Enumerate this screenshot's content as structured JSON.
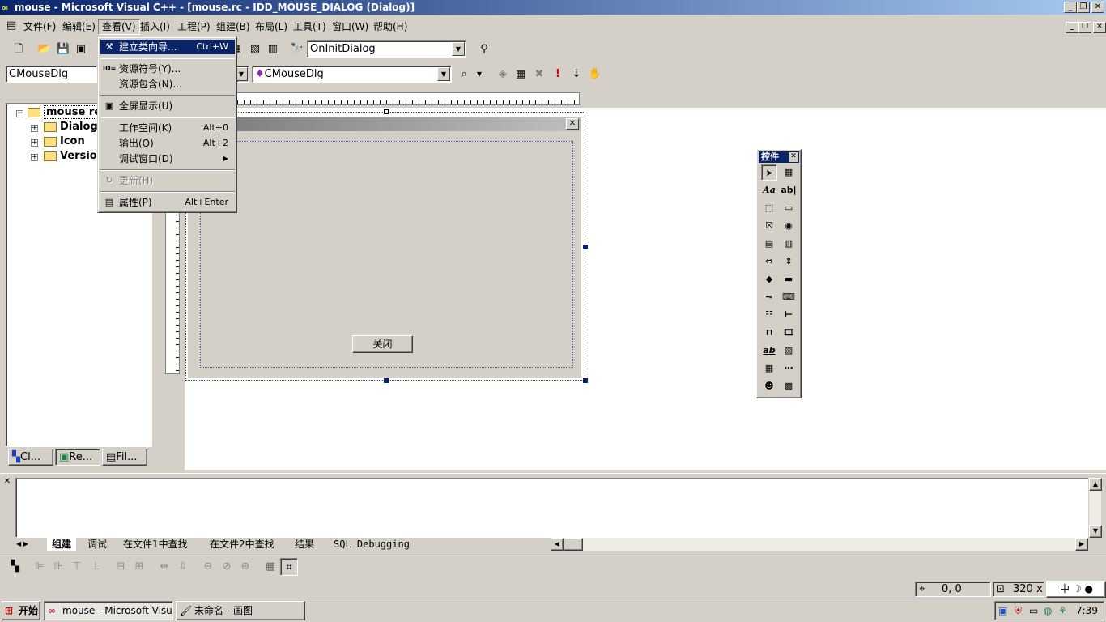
{
  "window": {
    "title": "mouse - Microsoft Visual C++ - [mouse.rc - IDD_MOUSE_DIALOG (Dialog)]"
  },
  "menubar": {
    "items": [
      "文件(F)",
      "编辑(E)",
      "查看(V)",
      "插入(I)",
      "工程(P)",
      "组建(B)",
      "布局(L)",
      "工具(T)",
      "窗口(W)",
      "帮助(H)"
    ]
  },
  "toolbar": {
    "function_combo": "OnInitDialog",
    "class_combo": "CMouseDlg",
    "class_combo2": "CMouseDlg"
  },
  "view_menu": {
    "class_wizard": {
      "label": "建立类向导...",
      "shortcut": "Ctrl+W"
    },
    "resource_symbols": {
      "label": "资源符号(Y)..."
    },
    "resource_includes": {
      "label": "资源包含(N)..."
    },
    "full_screen": {
      "label": "全屏显示(U)"
    },
    "workspace": {
      "label": "工作空间(K)",
      "shortcut": "Alt+0"
    },
    "output": {
      "label": "输出(O)",
      "shortcut": "Alt+2"
    },
    "debug_windows": {
      "label": "调试窗口(D)"
    },
    "refresh": {
      "label": "更新(H)"
    },
    "properties": {
      "label": "属性(P)",
      "shortcut": "Alt+Enter"
    }
  },
  "workspace": {
    "root": "mouse resources",
    "nodes": [
      "Dialog",
      "Icon",
      "Version"
    ],
    "tabs": [
      "Cl...",
      "Re...",
      "Fil..."
    ]
  },
  "dialog": {
    "close_button": "关闭"
  },
  "palette": {
    "title": "控件",
    "controls": [
      "Aa",
      "ab|",
      "ab"
    ]
  },
  "output_tabs": [
    "组建",
    "调试",
    "在文件1中查找",
    "在文件2中查找",
    "结果",
    "SQL Debugging"
  ],
  "status": {
    "position": "0, 0",
    "size": "320 x",
    "ime": "中"
  },
  "taskbar": {
    "start": "开始",
    "tasks": [
      "mouse - Microsoft Visual ...",
      "未命名 - 画图"
    ],
    "clock": "7:39"
  }
}
